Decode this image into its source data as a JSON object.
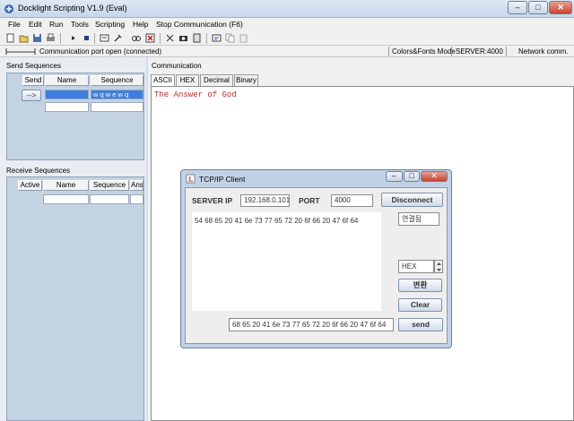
{
  "window": {
    "title": "Docklight Scripting V1.9 (Eval)",
    "min": "–",
    "max": "□",
    "close": "✕"
  },
  "menu": {
    "items": [
      "File",
      "Edit",
      "Run",
      "Tools",
      "Scripting",
      "Help",
      "Stop Communication  (F6)"
    ]
  },
  "toolbar": {
    "icons": [
      "new-icon",
      "open-icon",
      "save-icon",
      "print-icon",
      "run-icon",
      "stop-icon",
      "options-icon",
      "find-icon",
      "clear-icon",
      "send-icon",
      "capture-icon",
      "log-icon",
      "script-icon",
      "copy-icon",
      "paste-icon"
    ]
  },
  "status": {
    "port": "Communication port open (connected)",
    "mode": "Colors&Fonts Mode",
    "server": "SERVER:4000",
    "network": "Network comm."
  },
  "send_sequences": {
    "title": "Send Sequences",
    "headers": [
      "Send",
      "Name",
      "Sequence"
    ],
    "send_label": "-->",
    "row_sequence": "w q w e w q"
  },
  "receive_sequences": {
    "title": "Receive Sequences",
    "headers": [
      "Active",
      "Name",
      "Sequence",
      "Answ"
    ]
  },
  "communication": {
    "title": "Communication",
    "tabs": [
      "ASCII",
      "HEX",
      "Decimal",
      "Binary"
    ],
    "text": "The Answer of God",
    "text_color": "#b42d2d"
  },
  "dialog": {
    "title": "TCP/IP Client",
    "server_label": "SERVER IP",
    "server_ip": "192.168.0.101",
    "port_label": "PORT",
    "port": "4000",
    "disconnect": "Disconnect",
    "status": "연결됨",
    "hex_output": "54 68 65 20 41 6e 73 77 65 72 20 6f 66 20 47 6f 64",
    "format": "HEX",
    "convert": "변환",
    "clear": "Clear",
    "send_input": "68 65 20 41 6e 73 77 65 72 20 6f 66 20 47 6f 64",
    "send": "send"
  }
}
